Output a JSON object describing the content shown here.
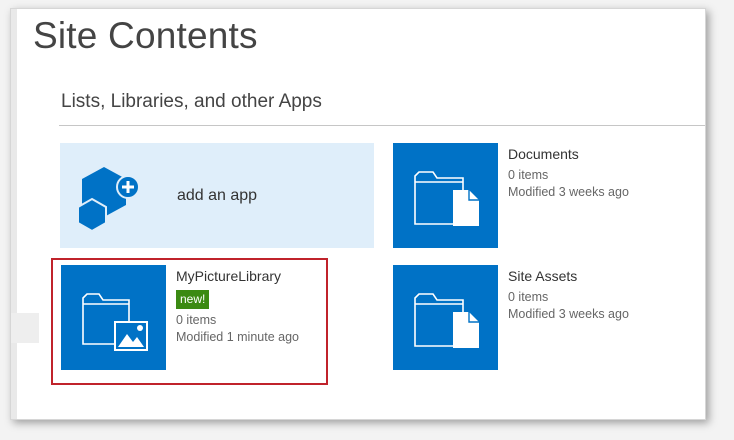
{
  "page": {
    "title": "Site Contents"
  },
  "section": {
    "title": "Lists, Libraries, and other Apps"
  },
  "add_app": {
    "label": "add an app",
    "icon": "add-app-hexagon-icon"
  },
  "apps": [
    {
      "name": "Documents",
      "items": "0 items",
      "modified": "Modified 3 weeks ago",
      "icon": "document-library-icon"
    },
    {
      "name": "MyPictureLibrary",
      "badge": "new!",
      "items": "0 items",
      "modified": "Modified 1 minute ago",
      "icon": "picture-library-icon"
    },
    {
      "name": "Site Assets",
      "items": "0 items",
      "modified": "Modified 3 weeks ago",
      "icon": "document-library-icon"
    }
  ],
  "colors": {
    "tile_blue": "#0072c6",
    "add_tile_bg": "#dfeefa",
    "badge_green": "#3b8a12",
    "highlight_red": "#c0232b"
  }
}
